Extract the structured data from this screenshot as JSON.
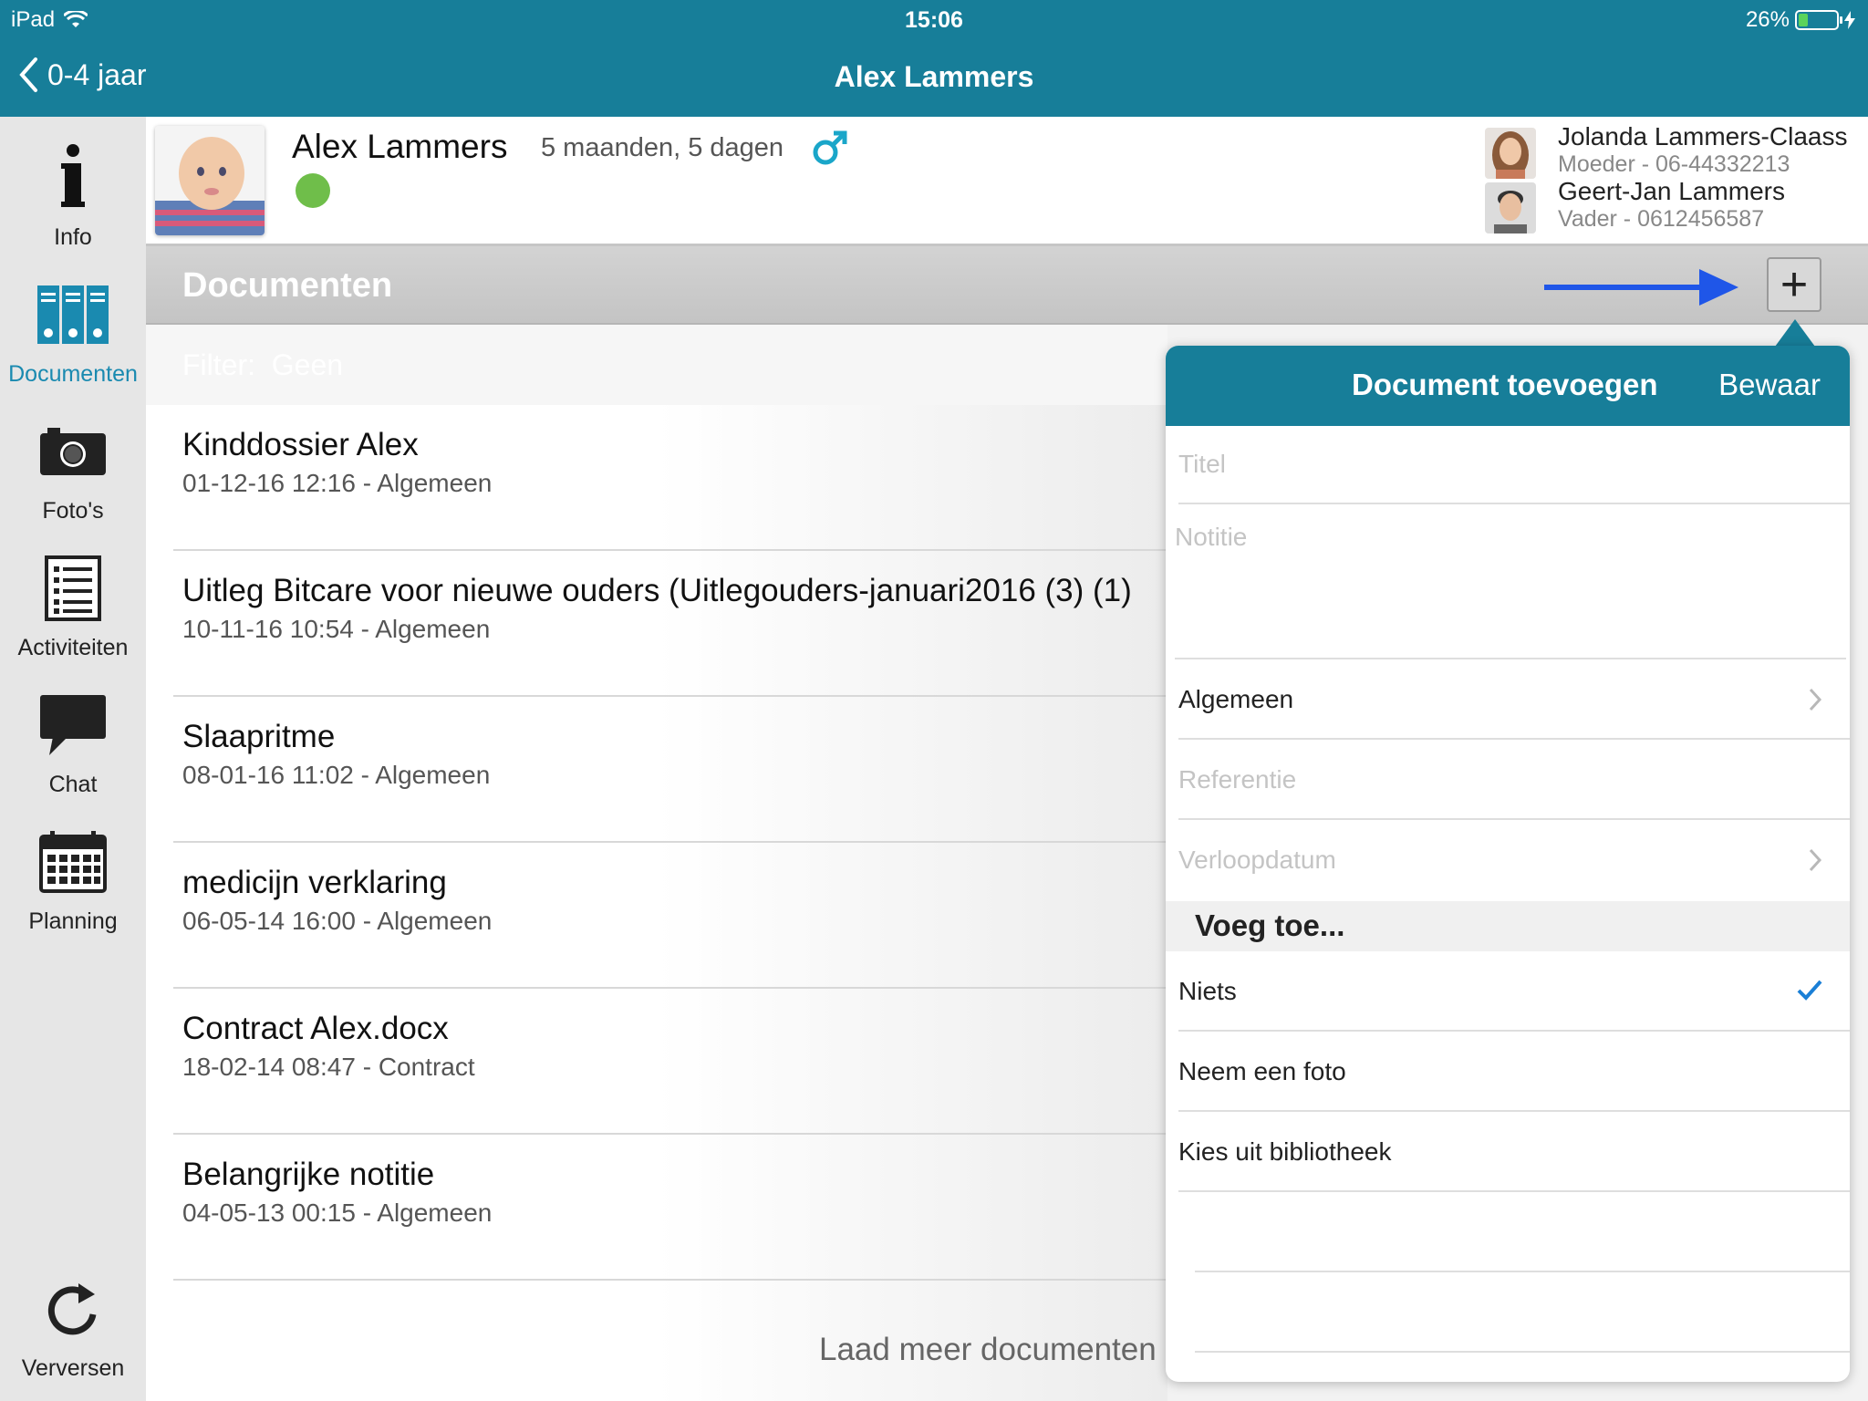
{
  "status": {
    "device": "iPad",
    "time": "15:06",
    "battery_text": "26%",
    "battery_level": 0.26
  },
  "nav": {
    "back_label": "0-4 jaar",
    "title": "Alex Lammers"
  },
  "sidebar": {
    "items": [
      {
        "label": "Info",
        "icon": "info-icon",
        "active": false
      },
      {
        "label": "Documenten",
        "icon": "binders-icon",
        "active": true
      },
      {
        "label": "Foto's",
        "icon": "camera-icon",
        "active": false
      },
      {
        "label": "Activiteiten",
        "icon": "checklist-icon",
        "active": false
      },
      {
        "label": "Chat",
        "icon": "chat-bubble-icon",
        "active": false
      },
      {
        "label": "Planning",
        "icon": "calendar-icon",
        "active": false
      }
    ],
    "refresh_label": "Verversen"
  },
  "profile": {
    "name": "Alex Lammers",
    "age": "5 maanden, 5 dagen",
    "gender_icon": "male-icon",
    "status_color": "#6fbe4a",
    "parents": [
      {
        "name": "Jolanda Lammers-Claass",
        "info": "Moeder - 06-44332213"
      },
      {
        "name": "Geert-Jan Lammers",
        "info": "Vader - 0612456587"
      }
    ]
  },
  "section": {
    "title": "Documenten",
    "add_label": "+"
  },
  "filter": {
    "label": "Filter:",
    "value": "Geen"
  },
  "documents": [
    {
      "title": "Kinddossier Alex",
      "subtitle": "01-12-16 12:16 - Algemeen"
    },
    {
      "title": "Uitleg Bitcare voor nieuwe ouders (Uitlegouders-januari2016 (3) (1)",
      "subtitle": "10-11-16 10:54 - Algemeen"
    },
    {
      "title": "Slaapritme",
      "subtitle": "08-01-16 11:02 - Algemeen"
    },
    {
      "title": "medicijn verklaring",
      "subtitle": "06-05-14 16:00 - Algemeen"
    },
    {
      "title": "Contract Alex.docx",
      "subtitle": "18-02-14 08:47 - Contract"
    },
    {
      "title": "Belangrijke notitie",
      "subtitle": "04-05-13 00:15 - Algemeen"
    }
  ],
  "load_more": "Laad meer documenten",
  "popover": {
    "title": "Document toevoegen",
    "save_label": "Bewaar",
    "fields": {
      "title_placeholder": "Titel",
      "note_placeholder": "Notitie",
      "category": "Algemeen",
      "reference_placeholder": "Referentie",
      "expiry_placeholder": "Verloopdatum"
    },
    "attach_header": "Voeg toe...",
    "attach_options": [
      {
        "label": "Niets",
        "selected": true
      },
      {
        "label": "Neem een foto",
        "selected": false
      },
      {
        "label": "Kies uit bibliotheek",
        "selected": false
      }
    ]
  },
  "colors": {
    "brand": "#177e99",
    "accent": "#1a8ab0",
    "arrow": "#1f56e8"
  }
}
